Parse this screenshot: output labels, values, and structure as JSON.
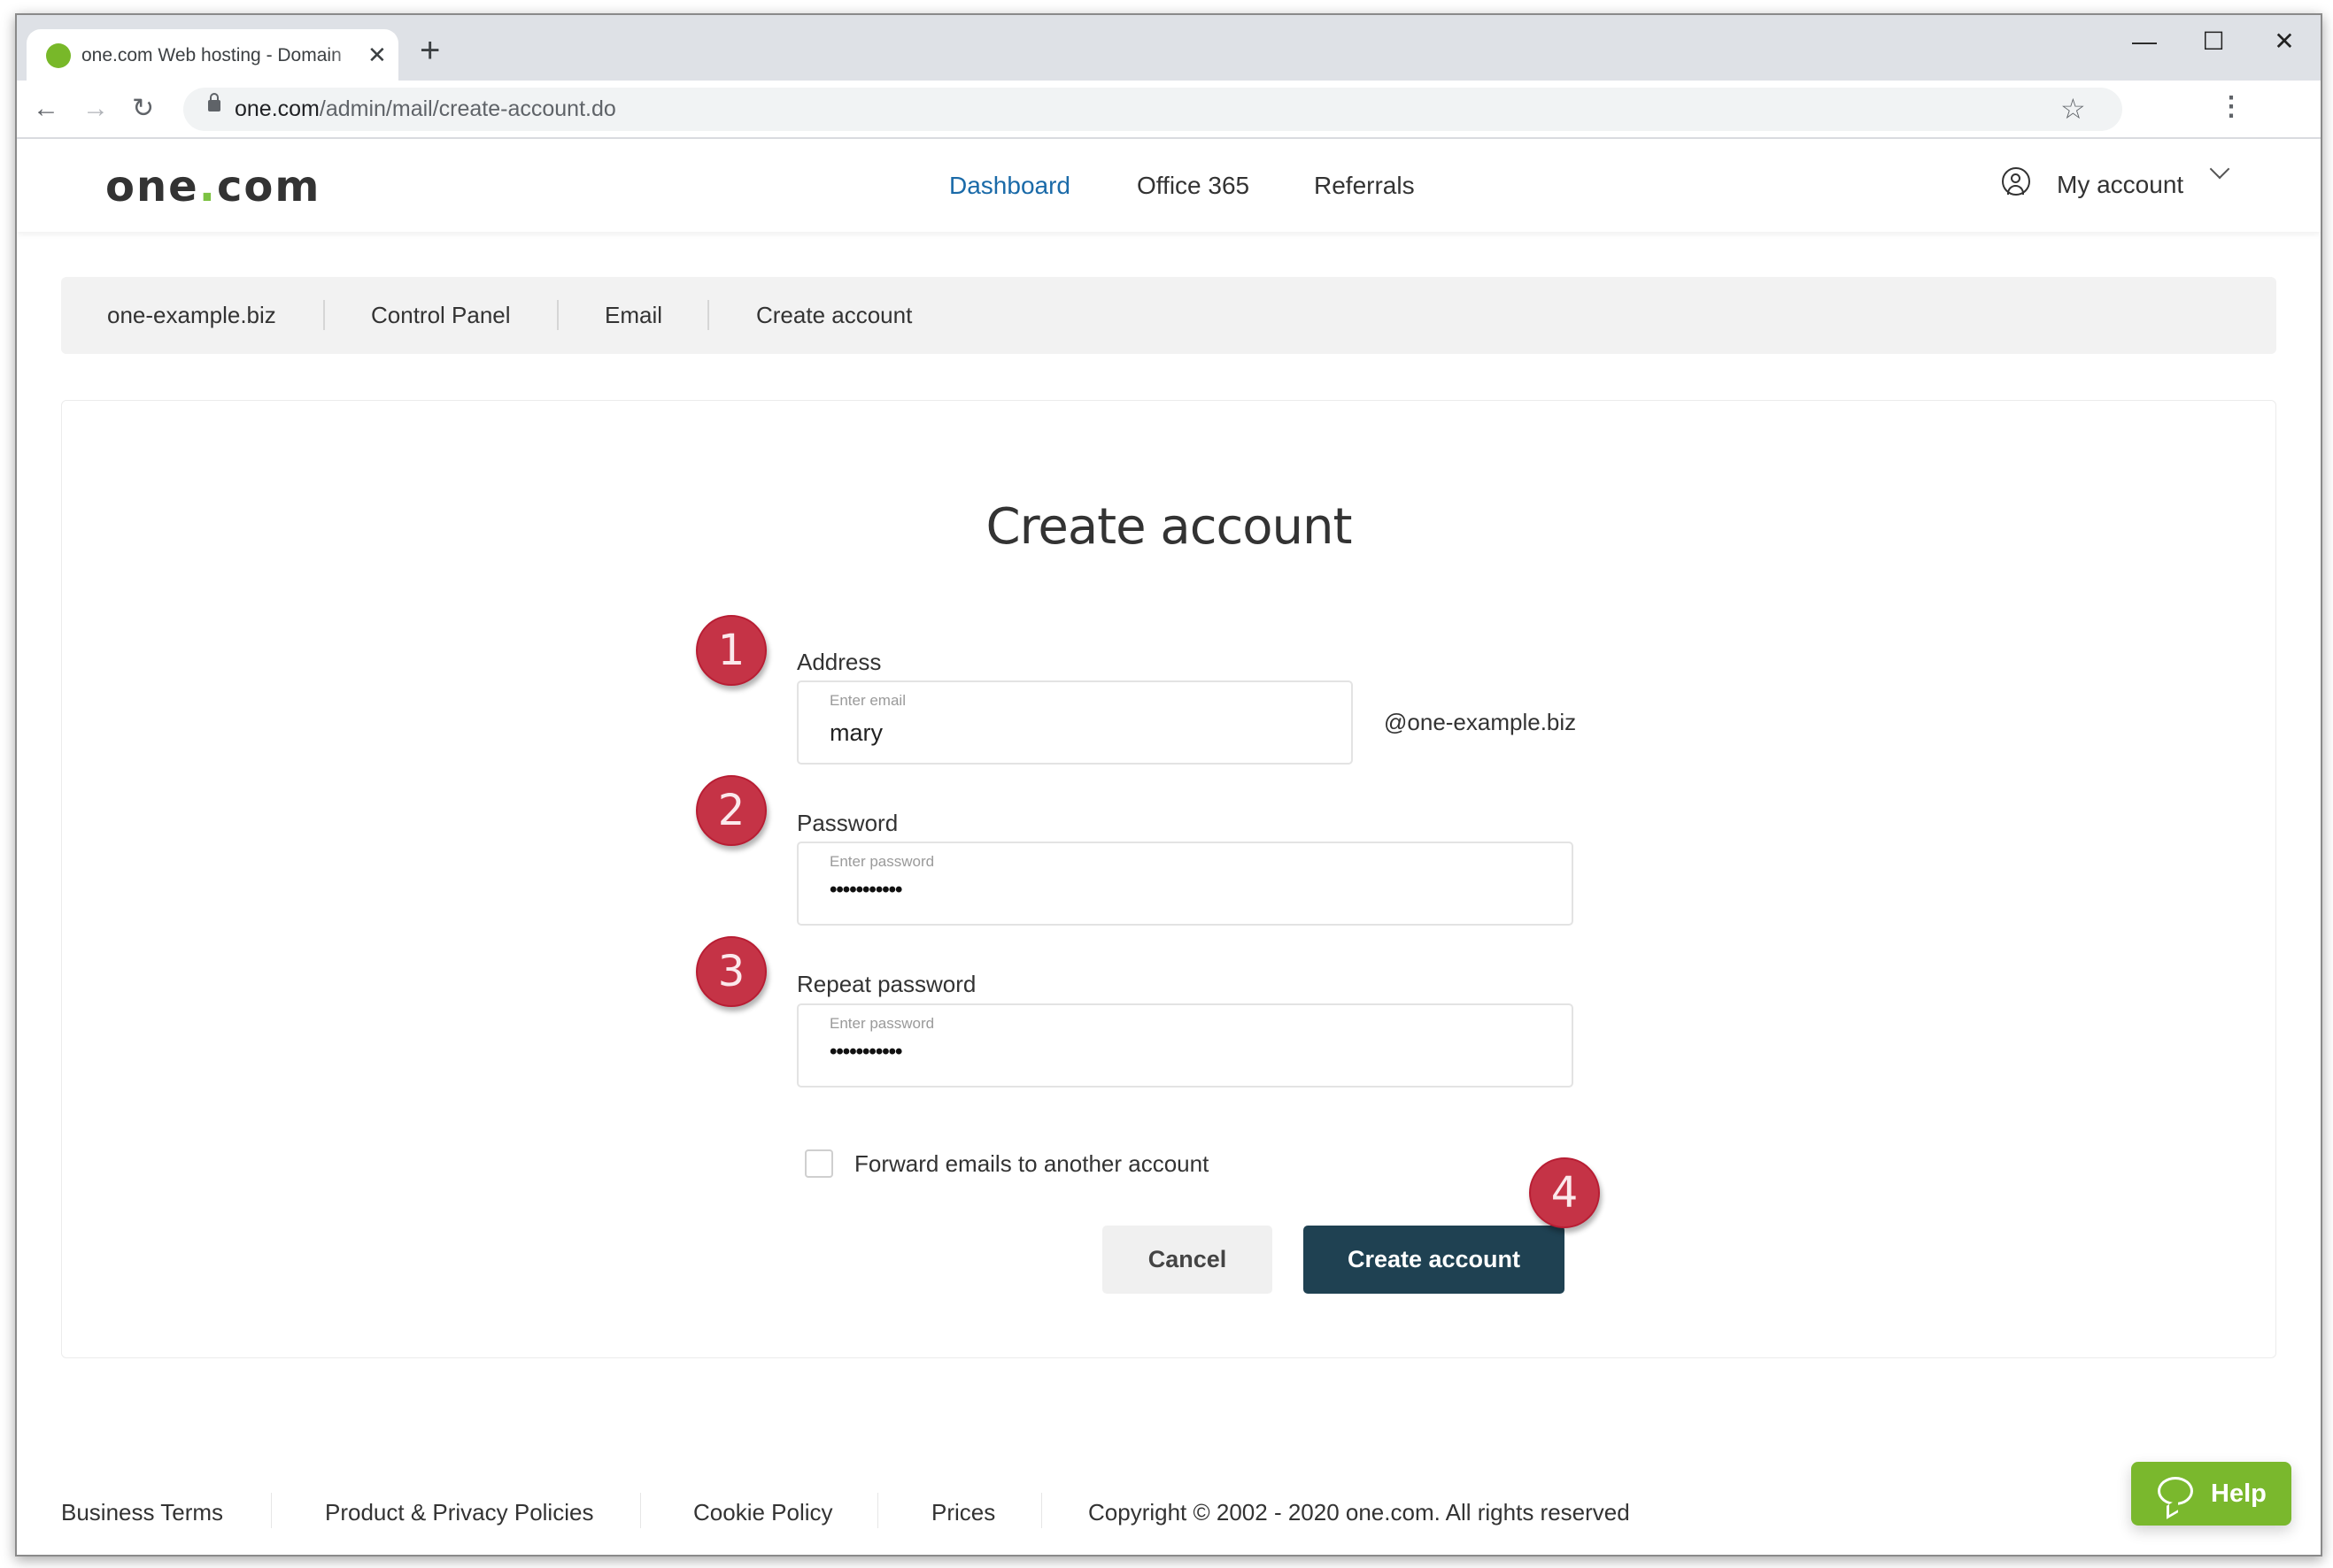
{
  "browser": {
    "tab_title": "one.com Web hosting  -  Domain",
    "tab_close": "✕",
    "new_tab": "+",
    "url_host": "one.com",
    "url_path": "/admin/mail/create-account.do",
    "back": "←",
    "forward": "→",
    "reload": "↻",
    "star": "☆",
    "menu": "⋮",
    "minimize": "—",
    "maximize": "☐",
    "close": "✕"
  },
  "header": {
    "logo_left": "one",
    "logo_dot": ".",
    "logo_right": "com",
    "nav": [
      {
        "label": "Dashboard",
        "active": true
      },
      {
        "label": "Office 365",
        "active": false
      },
      {
        "label": "Referrals",
        "active": false
      }
    ],
    "account_label": "My account"
  },
  "breadcrumb": [
    {
      "label": "one-example.biz"
    },
    {
      "label": "Control Panel"
    },
    {
      "label": "Email"
    },
    {
      "label": "Create account"
    }
  ],
  "form": {
    "title": "Create account",
    "address": {
      "label": "Address",
      "placeholder": "Enter email",
      "value": "mary",
      "domain_suffix": "@one-example.biz"
    },
    "password": {
      "label": "Password",
      "placeholder": "Enter password",
      "masked_value": "•••••••••••"
    },
    "repeat_password": {
      "label": "Repeat password",
      "placeholder": "Enter password",
      "masked_value": "•••••••••••"
    },
    "forward_checkbox": {
      "label": "Forward emails to another account",
      "checked": false
    },
    "cancel_label": "Cancel",
    "submit_label": "Create account"
  },
  "annotations": {
    "step1": "1",
    "step2": "2",
    "step3": "3",
    "step4": "4",
    "color": "#c53346"
  },
  "footer": {
    "links": [
      {
        "label": "Business Terms"
      },
      {
        "label": "Product & Privacy Policies"
      },
      {
        "label": "Cookie Policy"
      },
      {
        "label": "Prices"
      }
    ],
    "copyright": "Copyright © 2002 - 2020 one.com. All rights reserved",
    "help_label": "Help"
  },
  "colors": {
    "brand_green": "#7ab82d",
    "primary_button": "#1f4152",
    "active_nav": "#1a6aa8"
  }
}
